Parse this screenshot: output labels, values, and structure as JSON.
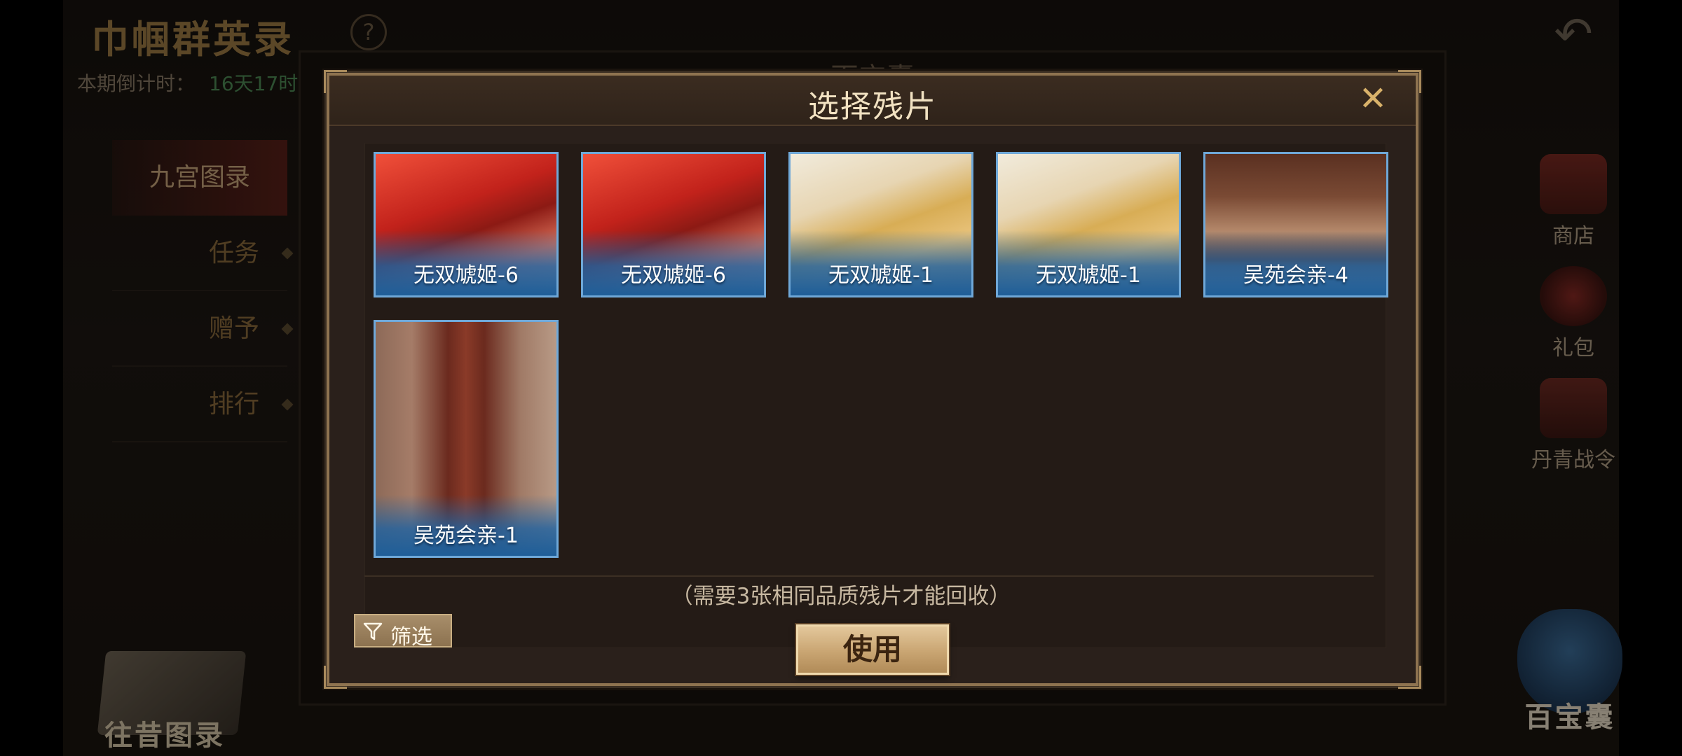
{
  "background": {
    "title": "巾帼群英录",
    "help_symbol": "?",
    "countdown_label": "本期倒计时：",
    "countdown_value": "16天17时",
    "nav": [
      {
        "label": "九宫图录"
      },
      {
        "label": "任务"
      },
      {
        "label": "赠予"
      },
      {
        "label": "排行"
      }
    ],
    "side_buttons": [
      {
        "label": "商店",
        "icon": "chest-icon"
      },
      {
        "label": "礼包",
        "icon": "gift-bag-icon"
      },
      {
        "label": "丹青战令",
        "icon": "battle-pass-icon"
      }
    ],
    "past_gallery_label": "往昔图录",
    "treasure_bag_label": "百宝囊",
    "back_panel_title": "百宝囊"
  },
  "modal": {
    "title": "选择残片",
    "close_symbol": "✕",
    "cards": [
      {
        "label": "无双虓姬-6",
        "art": "red-fabric"
      },
      {
        "label": "无双虓姬-6",
        "art": "red-fabric"
      },
      {
        "label": "无双虓姬-1",
        "art": "aged-paper"
      },
      {
        "label": "无双虓姬-1",
        "art": "aged-paper"
      },
      {
        "label": "吴苑会亲-4",
        "art": "palace-hall"
      },
      {
        "label": "吴苑会亲-1",
        "art": "palace-pillar"
      }
    ],
    "hint": "（需要3张相同品质残片才能回收）",
    "filter_label": "筛选",
    "use_label": "使用"
  },
  "colors": {
    "frame_gold": "#8e7350",
    "card_border_blue": "#6fa8d8",
    "title_text": "#f2e2c2",
    "close_gold": "#d9b26a"
  }
}
